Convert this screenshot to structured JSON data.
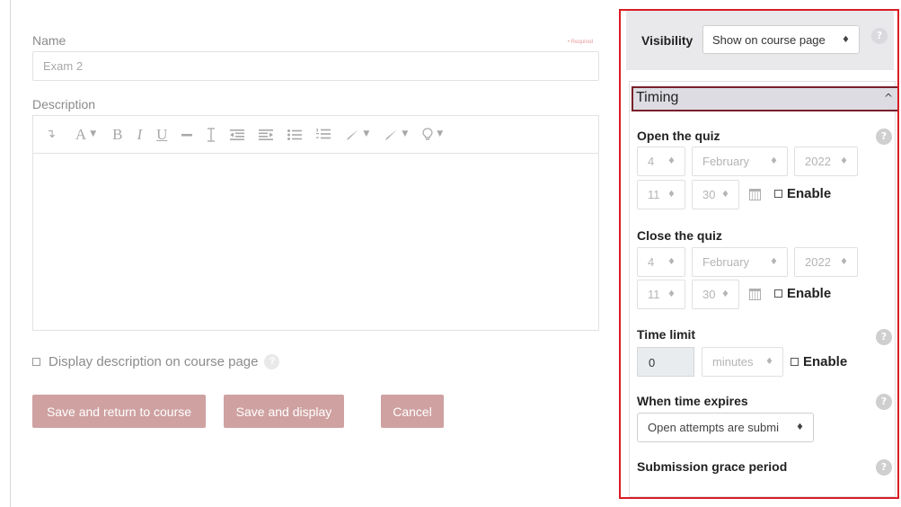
{
  "form": {
    "name_label": "Name",
    "required_text": "• Required",
    "name_value": "Exam 2",
    "description_label": "Description",
    "display_description_label": "Display description on course page",
    "buttons": {
      "save_return": "Save and return to course",
      "save_display": "Save and display",
      "cancel": "Cancel"
    }
  },
  "toolbar": {
    "bold": "B",
    "italic": "I",
    "underline": "U",
    "font": "A"
  },
  "visibility": {
    "label": "Visibility",
    "selected": "Show on course page"
  },
  "timing": {
    "title": "Timing",
    "open": {
      "label": "Open the quiz",
      "day": "4",
      "month": "February",
      "year": "2022",
      "hour": "11",
      "minute": "30",
      "enable_label": "Enable"
    },
    "close": {
      "label": "Close the quiz",
      "day": "4",
      "month": "February",
      "year": "2022",
      "hour": "11",
      "minute": "30",
      "enable_label": "Enable"
    },
    "time_limit": {
      "label": "Time limit",
      "value": "0",
      "unit": "minutes",
      "enable_label": "Enable"
    },
    "when_expires": {
      "label": "When time expires",
      "selected": "Open attempts are submi"
    },
    "grace_period": {
      "label": "Submission grace period"
    }
  },
  "icons": {
    "help": "?",
    "select_arrow": "♦",
    "collapse": "^"
  },
  "colors": {
    "highlight_border": "#d91c24",
    "button_bg": "#cfa1a1",
    "timing_header_border": "#7a1f2a"
  }
}
